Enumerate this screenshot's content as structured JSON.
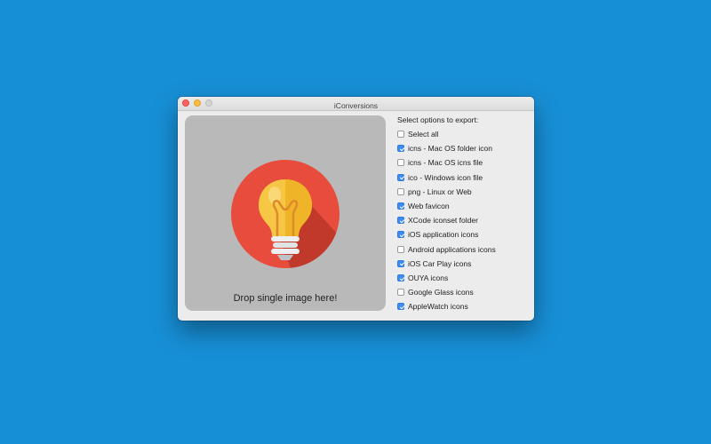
{
  "window": {
    "title": "iConversions"
  },
  "dropzone": {
    "label": "Drop single image here!",
    "icon": "lightbulb-icon"
  },
  "options": {
    "heading": "Select options to export:",
    "items": [
      {
        "key": "select-all",
        "label": "Select all",
        "checked": false
      },
      {
        "key": "icns-folder",
        "label": "icns - Mac OS folder icon",
        "checked": true
      },
      {
        "key": "icns-file",
        "label": "icns - Mac OS icns file",
        "checked": false
      },
      {
        "key": "ico-windows",
        "label": "ico - Windows icon file",
        "checked": true
      },
      {
        "key": "png-linux-web",
        "label": "png - Linux or Web",
        "checked": false
      },
      {
        "key": "web-favicon",
        "label": "Web favicon",
        "checked": true
      },
      {
        "key": "xcode-iconset",
        "label": "XCode iconset folder",
        "checked": true
      },
      {
        "key": "ios-app-icons",
        "label": "iOS application icons",
        "checked": true
      },
      {
        "key": "android-app-icons",
        "label": "Android applications icons",
        "checked": false
      },
      {
        "key": "ios-carplay",
        "label": "iOS Car Play icons",
        "checked": true
      },
      {
        "key": "ouya",
        "label": "OUYA icons",
        "checked": true
      },
      {
        "key": "google-glass",
        "label": "Google Glass icons",
        "checked": false
      },
      {
        "key": "applewatch",
        "label": "AppleWatch icons",
        "checked": true
      }
    ]
  },
  "colors": {
    "desktop": "#178fd6",
    "checkbox_on": "#3b8cf6",
    "icon_circle": "#e74c3c",
    "bulb_glass": "#f6c744"
  }
}
